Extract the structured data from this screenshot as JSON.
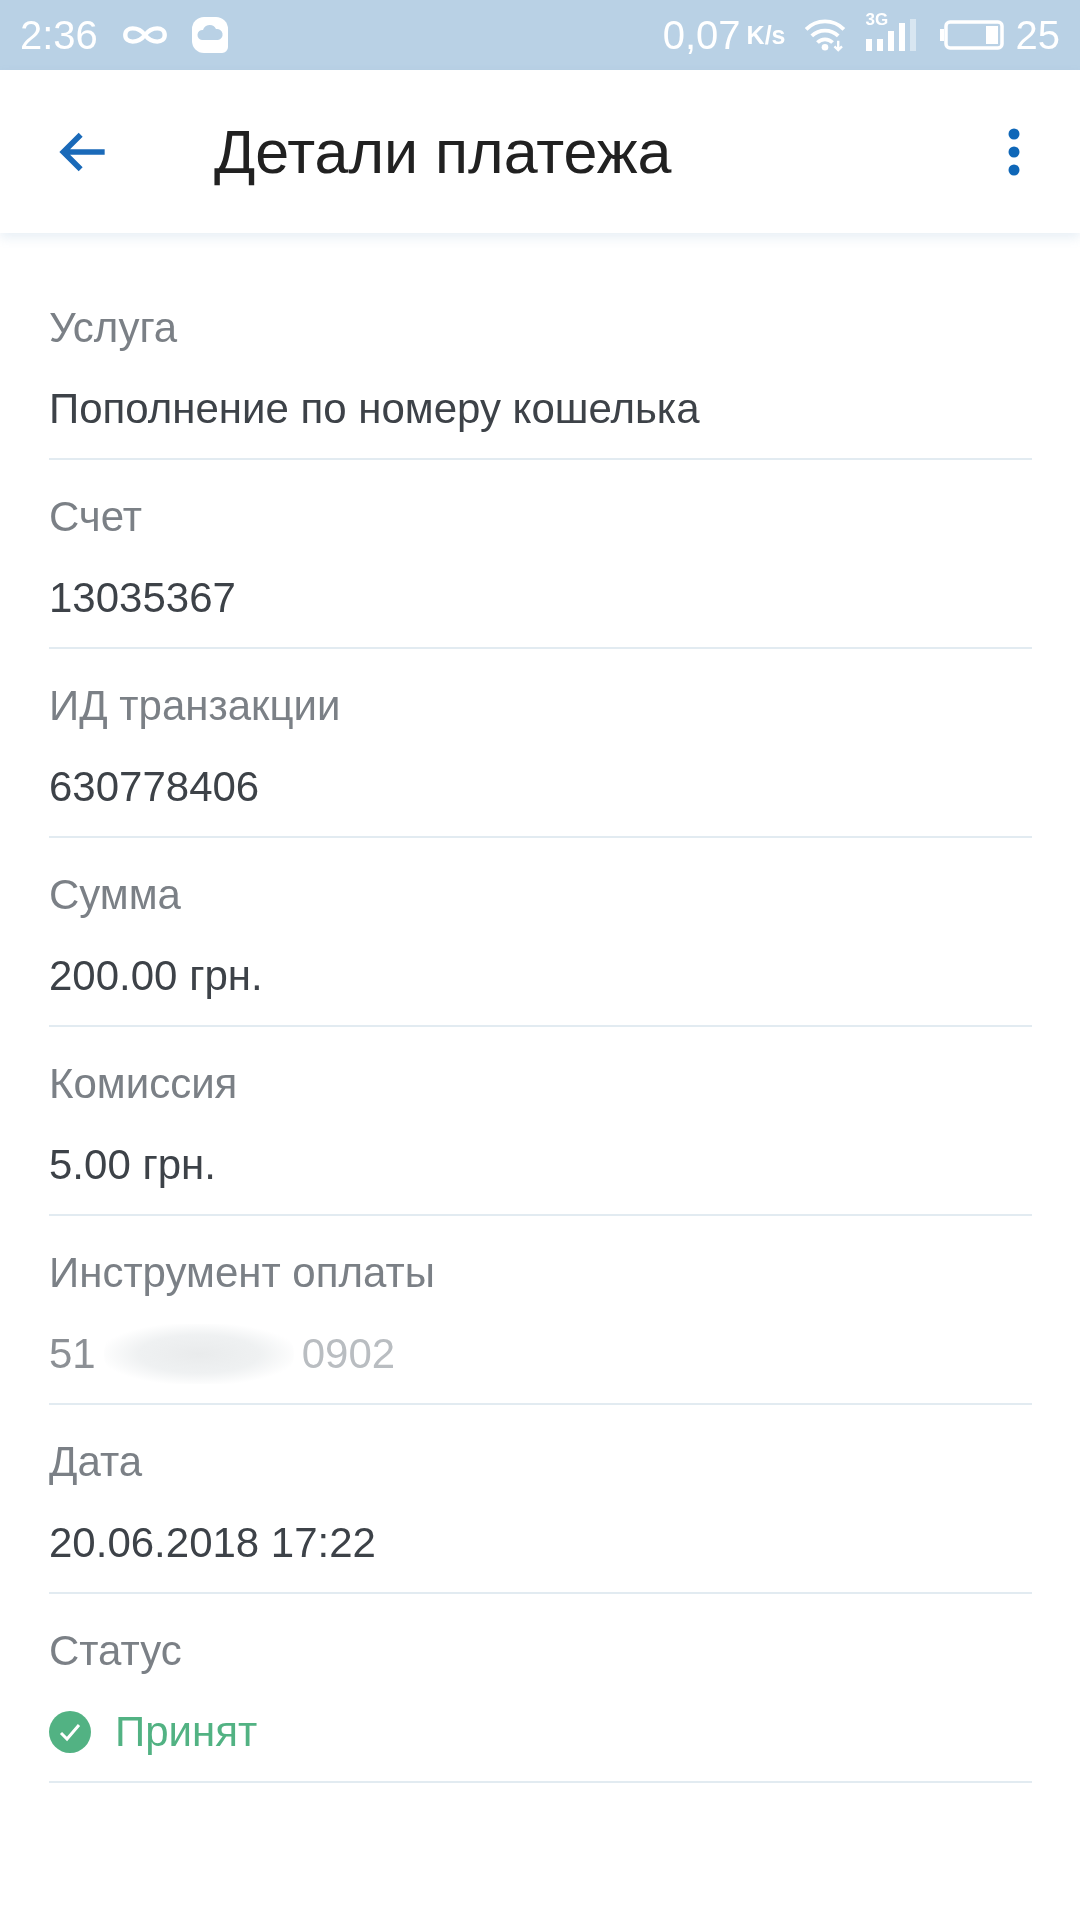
{
  "status_bar": {
    "time": "2:36",
    "speed": "0,07",
    "speed_unit": "K/s",
    "network_type": "3G",
    "battery": "25"
  },
  "app_bar": {
    "title": "Детали платежа"
  },
  "fields": [
    {
      "kind": "text",
      "label": "Услуга",
      "value": "Пополнение по номеру кошелька"
    },
    {
      "kind": "text",
      "label": "Счет",
      "value": "13035367"
    },
    {
      "kind": "text",
      "label": "ИД транзакции",
      "value": "630778406"
    },
    {
      "kind": "text",
      "label": "Сумма",
      "value": "200.00 грн."
    },
    {
      "kind": "text",
      "label": "Комиссия",
      "value": "5.00 грн."
    },
    {
      "kind": "redacted",
      "label": "Инструмент оплаты",
      "value_start": "51",
      "value_end": "0902"
    },
    {
      "kind": "text",
      "label": "Дата",
      "value": "20.06.2018 17:22"
    },
    {
      "kind": "status",
      "label": "Статус",
      "value": "Принят"
    }
  ]
}
